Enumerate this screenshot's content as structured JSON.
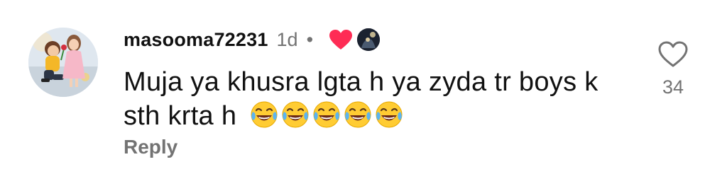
{
  "comment": {
    "username": "masooma72231",
    "timestamp": "1d",
    "separator": "•",
    "text": "Muja ya khusra lgta h ya zyda tr boys k sth krta h",
    "emoji": [
      "face-with-tears-of-joy",
      "face-with-tears-of-joy",
      "face-with-tears-of-joy",
      "face-with-tears-of-joy",
      "face-with-tears-of-joy"
    ],
    "creator_liked": true,
    "reply_label": "Reply",
    "like_count": "34"
  },
  "colors": {
    "secondary_text": "#737373",
    "heart_red": "#fe2c55",
    "primary_text": "#111111"
  }
}
